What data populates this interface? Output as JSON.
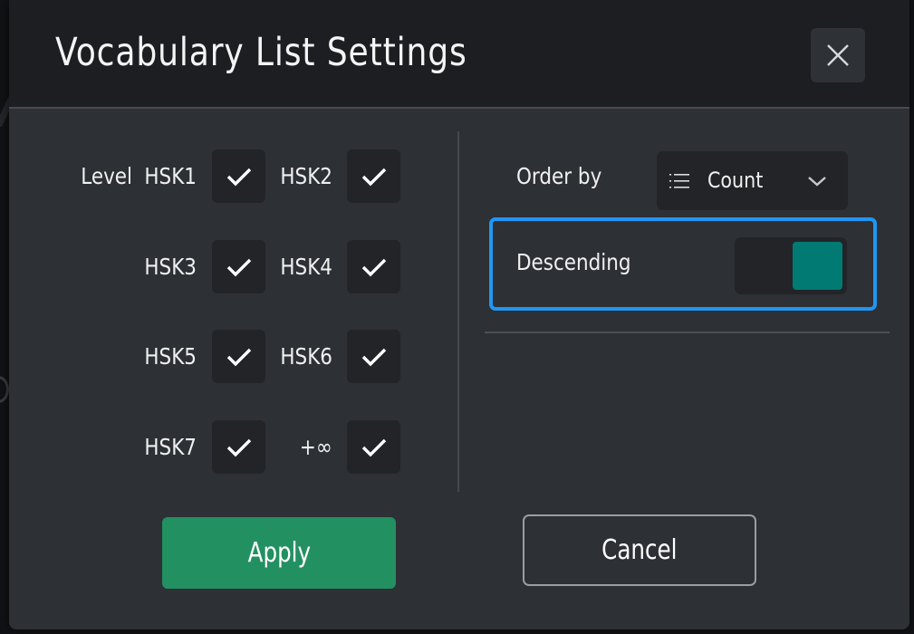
{
  "dialog": {
    "title": "Vocabulary List Settings",
    "close_icon": "close-x-icon"
  },
  "levels": {
    "label": "Level",
    "items": [
      {
        "label": "HSK1",
        "checked": true
      },
      {
        "label": "HSK2",
        "checked": true
      },
      {
        "label": "HSK3",
        "checked": true
      },
      {
        "label": "HSK4",
        "checked": true
      },
      {
        "label": "HSK5",
        "checked": true
      },
      {
        "label": "HSK6",
        "checked": true
      },
      {
        "label": "HSK7",
        "checked": true
      },
      {
        "label": "+∞",
        "checked": true
      }
    ]
  },
  "order": {
    "label": "Order by",
    "selected": "Count",
    "icon": "list-icon",
    "chevron": "chevron-down-icon"
  },
  "descending": {
    "label": "Descending",
    "on": true,
    "focused": true
  },
  "buttons": {
    "apply": "Apply",
    "cancel": "Cancel"
  },
  "colors": {
    "accent_focus": "#2196f3",
    "toggle_on": "#007a72",
    "apply": "#239062",
    "dialog_bg": "#2d3035",
    "header_bg": "#1c1e22"
  }
}
